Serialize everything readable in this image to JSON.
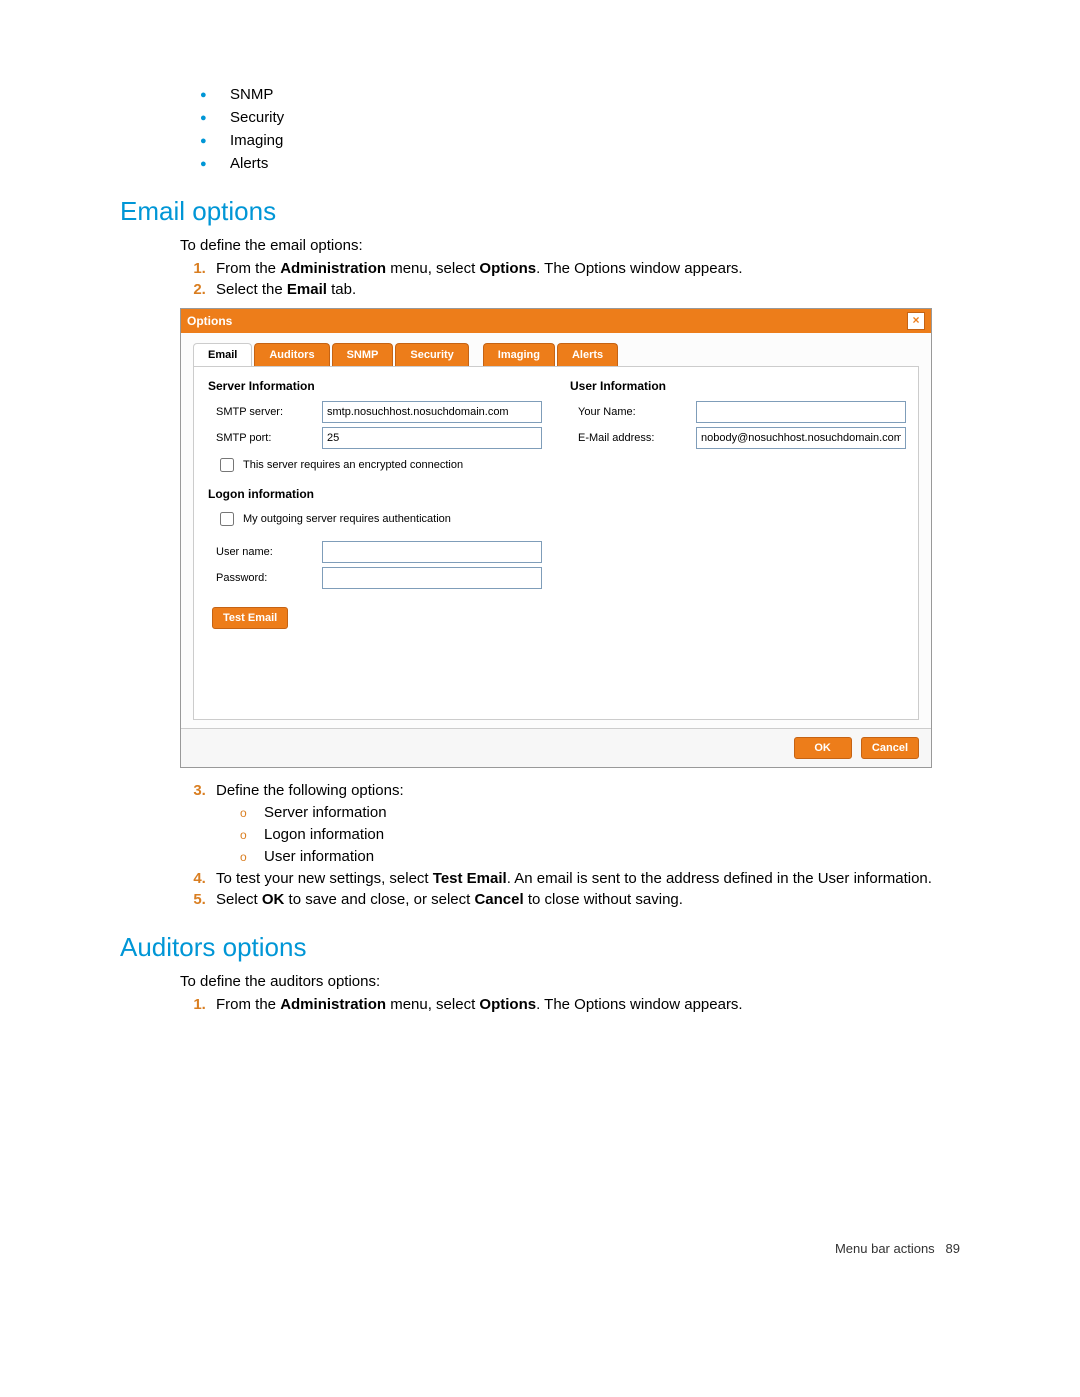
{
  "top_bullets": [
    "SNMP",
    "Security",
    "Imaging",
    "Alerts"
  ],
  "email_section": {
    "heading": "Email options",
    "intro": "To define the email options:",
    "steps": {
      "s1_pre": "From the ",
      "s1_b1": "Administration",
      "s1_mid": " menu, select ",
      "s1_b2": "Options",
      "s1_post": ". The Options window appears.",
      "s2_pre": "Select the ",
      "s2_b": "Email",
      "s2_post": " tab.",
      "s3": "Define the following options:",
      "s3_subs": [
        "Server information",
        "Logon information",
        "User information"
      ],
      "s4_pre": "To test your new settings, select ",
      "s4_b": "Test Email",
      "s4_post": ". An email is sent to the address defined in the User information.",
      "s5_pre": "Select ",
      "s5_b1": "OK",
      "s5_mid": " to save and close, or select ",
      "s5_b2": "Cancel",
      "s5_post": " to close without saving."
    }
  },
  "auditors_section": {
    "heading": "Auditors options",
    "intro": "To define the auditors options:",
    "s1_pre": "From the ",
    "s1_b1": "Administration",
    "s1_mid": " menu, select ",
    "s1_b2": "Options",
    "s1_post": ". The Options window appears."
  },
  "screenshot": {
    "title": "Options",
    "tabs": [
      "Email",
      "Auditors",
      "SNMP",
      "Security",
      "Imaging",
      "Alerts"
    ],
    "server_info_title": "Server Information",
    "smtp_server_label": "SMTP server:",
    "smtp_server_value": "smtp.nosuchhost.nosuchdomain.com",
    "smtp_port_label": "SMTP port:",
    "smtp_port_value": "25",
    "encrypted_label": "This server requires an encrypted connection",
    "logon_title": "Logon information",
    "auth_label": "My outgoing server requires authentication",
    "username_label": "User name:",
    "username_value": "",
    "password_label": "Password:",
    "password_value": "",
    "test_email_btn": "Test Email",
    "user_info_title": "User Information",
    "your_name_label": "Your Name:",
    "your_name_value": "",
    "email_addr_label": "E-Mail address:",
    "email_addr_value": "nobody@nosuchhost.nosuchdomain.com",
    "ok_btn": "OK",
    "cancel_btn": "Cancel"
  },
  "footer": {
    "text": "Menu bar actions",
    "page": "89"
  }
}
